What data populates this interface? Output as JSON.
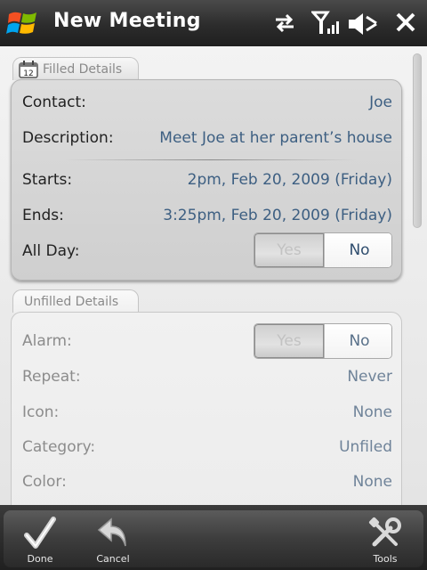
{
  "header": {
    "title": "New Meeting",
    "icons": [
      "windows-logo",
      "sync-arrows-icon",
      "signal-icon",
      "speaker-muted-icon",
      "close-icon"
    ]
  },
  "filled_section": {
    "tab_label": "Filled Details",
    "tab_icon": "calendar-icon",
    "calendar_day": "12",
    "contact": {
      "label": "Contact:",
      "value": "Joe"
    },
    "description": {
      "label": "Description:",
      "value": "Meet Joe at her parent’s house"
    },
    "starts": {
      "label": "Starts:",
      "value": "2pm, Feb 20, 2009 (Friday)"
    },
    "ends": {
      "label": "Ends:",
      "value": "3:25pm, Feb 20, 2009 (Friday)"
    },
    "all_day": {
      "label": "All Day:",
      "yes": "Yes",
      "no": "No",
      "selected": "No"
    }
  },
  "unfilled_section": {
    "tab_label": "Unfilled Details",
    "alarm": {
      "label": "Alarm:",
      "yes": "Yes",
      "no": "No",
      "selected": "No"
    },
    "repeat": {
      "label": "Repeat:",
      "value": "Never"
    },
    "icon": {
      "label": "Icon:",
      "value": "None"
    },
    "category": {
      "label": "Category:",
      "value": "Unfiled"
    },
    "color": {
      "label": "Color:",
      "value": "None"
    }
  },
  "toolbar": {
    "done_label": "Done",
    "cancel_label": "Cancel",
    "tools_label": "Tools"
  },
  "colors": {
    "accent_value": "#3d5f82",
    "titlebar": "#2c2c2c"
  }
}
